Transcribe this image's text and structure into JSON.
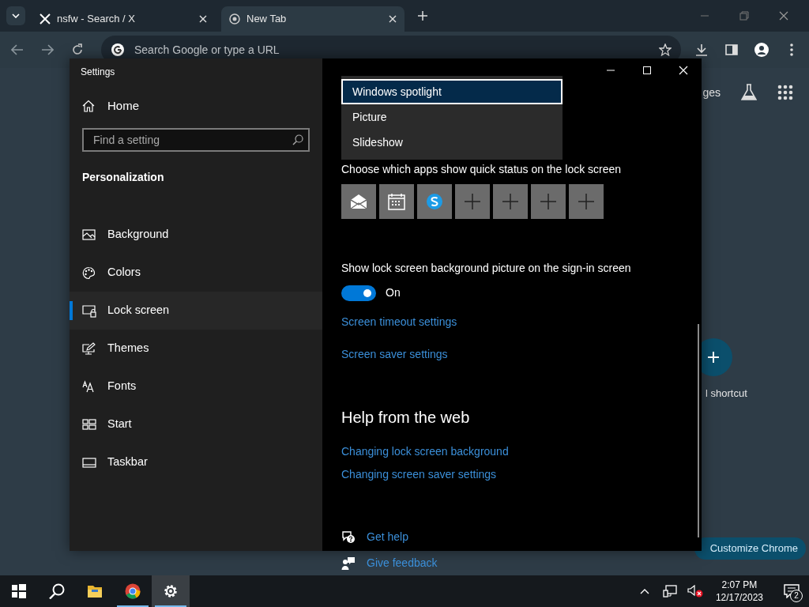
{
  "browser": {
    "tabs": [
      {
        "title": "nsfw - Search / X",
        "kind": "x",
        "selected": false
      },
      {
        "title": "New Tab",
        "kind": "chrome",
        "selected": true
      }
    ],
    "address_bar": {
      "placeholder": "Search Google or type a URL"
    },
    "page": {
      "header_link": "ges",
      "shortcut_label": "l shortcut",
      "customize_button": "Customize Chrome"
    }
  },
  "settings_window": {
    "title": "Settings",
    "sidebar": {
      "home": "Home",
      "search": {
        "placeholder": "Find a setting"
      },
      "section": "Personalization",
      "items": [
        {
          "label": "Background",
          "kind": "background",
          "selected": false
        },
        {
          "label": "Colors",
          "kind": "colors",
          "selected": false
        },
        {
          "label": "Lock screen",
          "kind": "lock",
          "selected": true
        },
        {
          "label": "Themes",
          "kind": "themes",
          "selected": false
        },
        {
          "label": "Fonts",
          "kind": "fonts",
          "selected": false
        },
        {
          "label": "Start",
          "kind": "start",
          "selected": false
        },
        {
          "label": "Taskbar",
          "kind": "taskbar",
          "selected": false
        }
      ]
    },
    "content": {
      "dropdown_options": [
        {
          "label": "Windows spotlight",
          "selected": true
        },
        {
          "label": "Picture",
          "selected": false
        },
        {
          "label": "Slideshow",
          "selected": false
        }
      ],
      "quick_status": {
        "label": "Choose which apps show quick status on the lock screen",
        "apps": [
          {
            "kind": "mail"
          },
          {
            "kind": "calendar"
          },
          {
            "kind": "skype"
          },
          {
            "kind": "add"
          },
          {
            "kind": "add"
          },
          {
            "kind": "add"
          },
          {
            "kind": "add"
          }
        ]
      },
      "sign_in_toggle": {
        "label": "Show lock screen background picture on the sign-in screen",
        "on": true,
        "state_text": "On"
      },
      "links": [
        "Screen timeout settings",
        "Screen saver settings"
      ],
      "help": {
        "title": "Help from the web",
        "links": [
          "Changing lock screen background",
          "Changing screen saver settings"
        ]
      },
      "support_links": [
        {
          "kind": "help",
          "label": "Get help"
        },
        {
          "kind": "feedback",
          "label": "Give feedback"
        }
      ]
    }
  },
  "taskbar": {
    "apps": [
      {
        "kind": "start",
        "running": false,
        "selected": false
      },
      {
        "kind": "search",
        "running": false,
        "selected": false
      },
      {
        "kind": "explorer",
        "running": false,
        "selected": false
      },
      {
        "kind": "chrome",
        "running": true,
        "selected": false
      },
      {
        "kind": "settings",
        "running": true,
        "selected": true
      }
    ],
    "time": "2:07 PM",
    "date": "12/17/2023",
    "notification_count": "2"
  }
}
